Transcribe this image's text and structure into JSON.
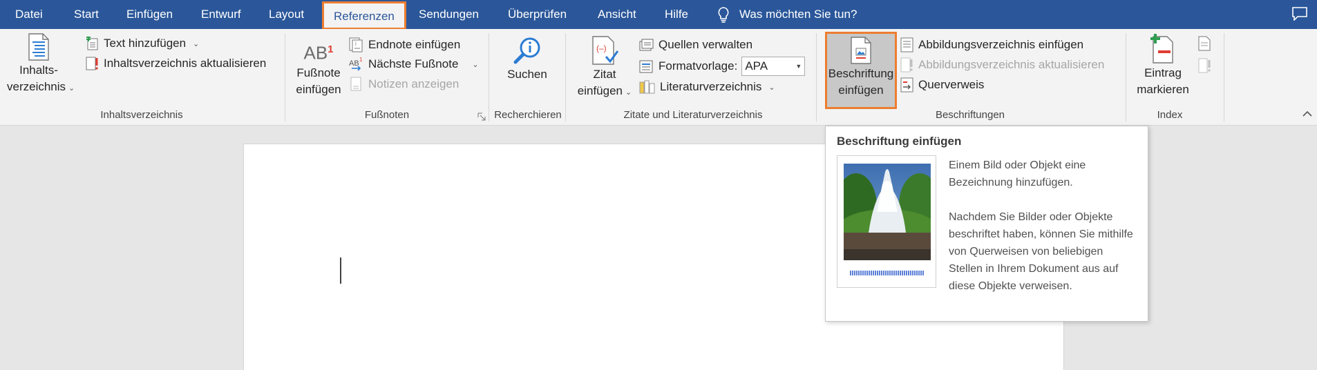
{
  "tabs": [
    "Datei",
    "Start",
    "Einfügen",
    "Entwurf",
    "Layout",
    "Referenzen",
    "Sendungen",
    "Überprüfen",
    "Ansicht",
    "Hilfe"
  ],
  "active_tab": "Referenzen",
  "tell_me": "Was möchten Sie tun?",
  "ribbon": {
    "toc": {
      "big_line1": "Inhalts-",
      "big_line2": "verzeichnis",
      "add_text": "Text hinzufügen",
      "update_toc": "Inhaltsverzeichnis aktualisieren",
      "group": "Inhaltsverzeichnis"
    },
    "footnotes": {
      "big_line1": "Fußnote",
      "big_line2": "einfügen",
      "ab_label": "AB",
      "ab_sup": "1",
      "insert_endnote": "Endnote einfügen",
      "next_footnote": "Nächste Fußnote",
      "show_notes": "Notizen anzeigen",
      "group": "Fußnoten"
    },
    "research": {
      "search": "Suchen",
      "group": "Recherchieren"
    },
    "citations": {
      "big_line1": "Zitat",
      "big_line2": "einfügen",
      "manage_sources": "Quellen verwalten",
      "style_label": "Formatvorlage:",
      "style_value": "APA",
      "bibliography": "Literaturverzeichnis",
      "group": "Zitate und Literaturverzeichnis"
    },
    "captions": {
      "big_line1": "Beschriftung",
      "big_line2": "einfügen",
      "insert_tof": "Abbildungsverzeichnis einfügen",
      "update_tof": "Abbildungsverzeichnis aktualisieren",
      "cross_ref": "Querverweis",
      "group": "Beschriftungen"
    },
    "index": {
      "big_line1": "Eintrag",
      "big_line2": "markieren",
      "group": "Index"
    }
  },
  "tooltip": {
    "title": "Beschriftung einfügen",
    "para1": "Einem Bild oder Objekt eine Bezeichnung hinzufügen.",
    "para2": "Nachdem Sie Bilder oder Objekte beschriftet haben, können Sie mithilfe von Querweisen von beliebigen Stellen in Ihrem Dokument aus auf diese Objekte verweisen."
  },
  "colors": {
    "tab_bar": "#2b579a",
    "highlight": "#ed7d31",
    "ribbon_bg": "#f3f3f3",
    "workspace_bg": "#e6e6e6"
  }
}
